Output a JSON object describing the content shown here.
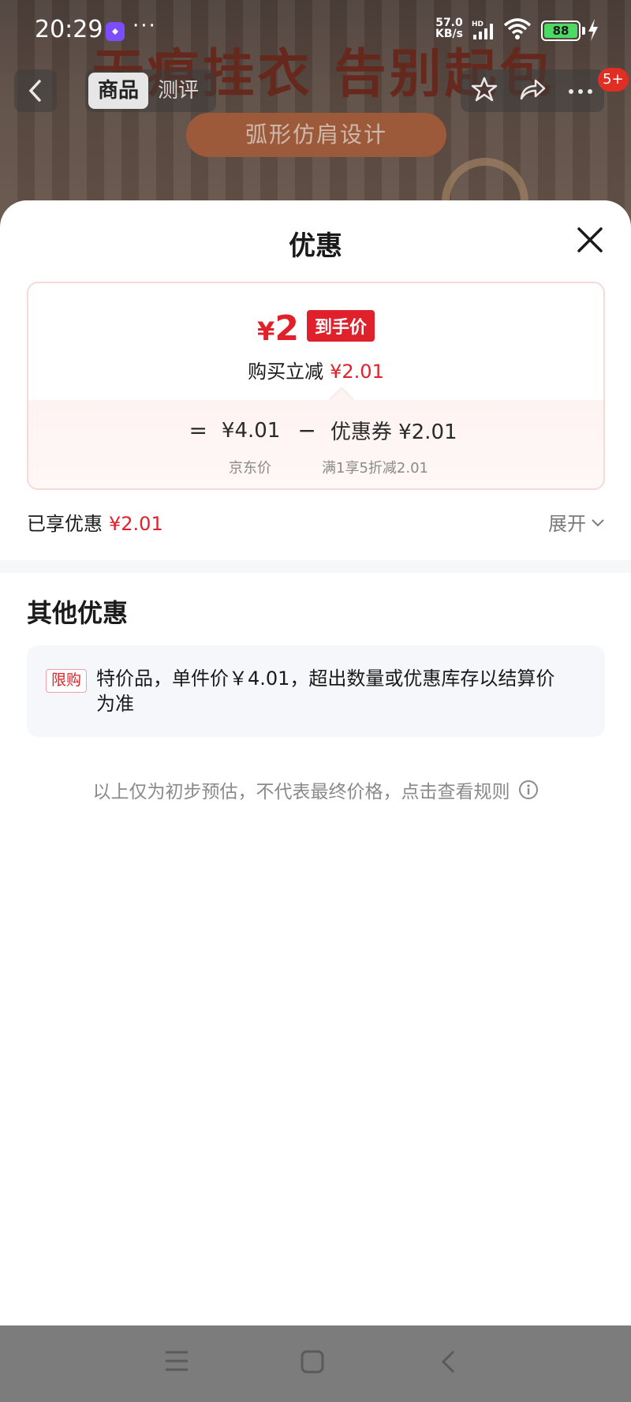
{
  "status_bar": {
    "time": "20:29",
    "dots": "···",
    "net_speed_value": "57.0",
    "net_speed_unit": "KB/s",
    "net_type": "HD",
    "battery": "88"
  },
  "background": {
    "banner_text": "无痕挂衣 告别起包",
    "pill_text": "弧形仿肩设计"
  },
  "nav": {
    "tabs": [
      {
        "label": "商品",
        "active": true
      },
      {
        "label": "测评",
        "active": false
      }
    ],
    "badge": "5+"
  },
  "sheet": {
    "title": "优惠",
    "price_card": {
      "currency": "¥",
      "final_price": "2",
      "final_tag": "到手价",
      "instant_label": "购买立减",
      "instant_value": "¥2.01",
      "equals": "=",
      "base_price": "¥4.01",
      "base_label": "京东价",
      "minus": "−",
      "coupon_text": "优惠券 ¥2.01",
      "coupon_label": "满1享5折减2.01"
    },
    "enjoyed": {
      "label": "已享优惠",
      "value": "¥2.01",
      "expand_label": "展开"
    },
    "other": {
      "title": "其他优惠",
      "tag": "限购",
      "text": "特价品，单件价￥4.01，超出数量或优惠库存以结算价为准"
    },
    "disclaimer": "以上仅为初步预估，不代表最终价格，点击查看规则"
  },
  "colors": {
    "accent_red": "#e0202a",
    "text_primary": "#1a1a1a",
    "text_secondary": "#8a8a8a",
    "nav_bar": "#7c7c7c"
  },
  "icons": [
    "back-icon",
    "star-icon",
    "share-icon",
    "more-icon",
    "close-icon",
    "chevron-down-icon",
    "info-icon",
    "menu-icon",
    "home-icon",
    "nav-back-icon"
  ]
}
